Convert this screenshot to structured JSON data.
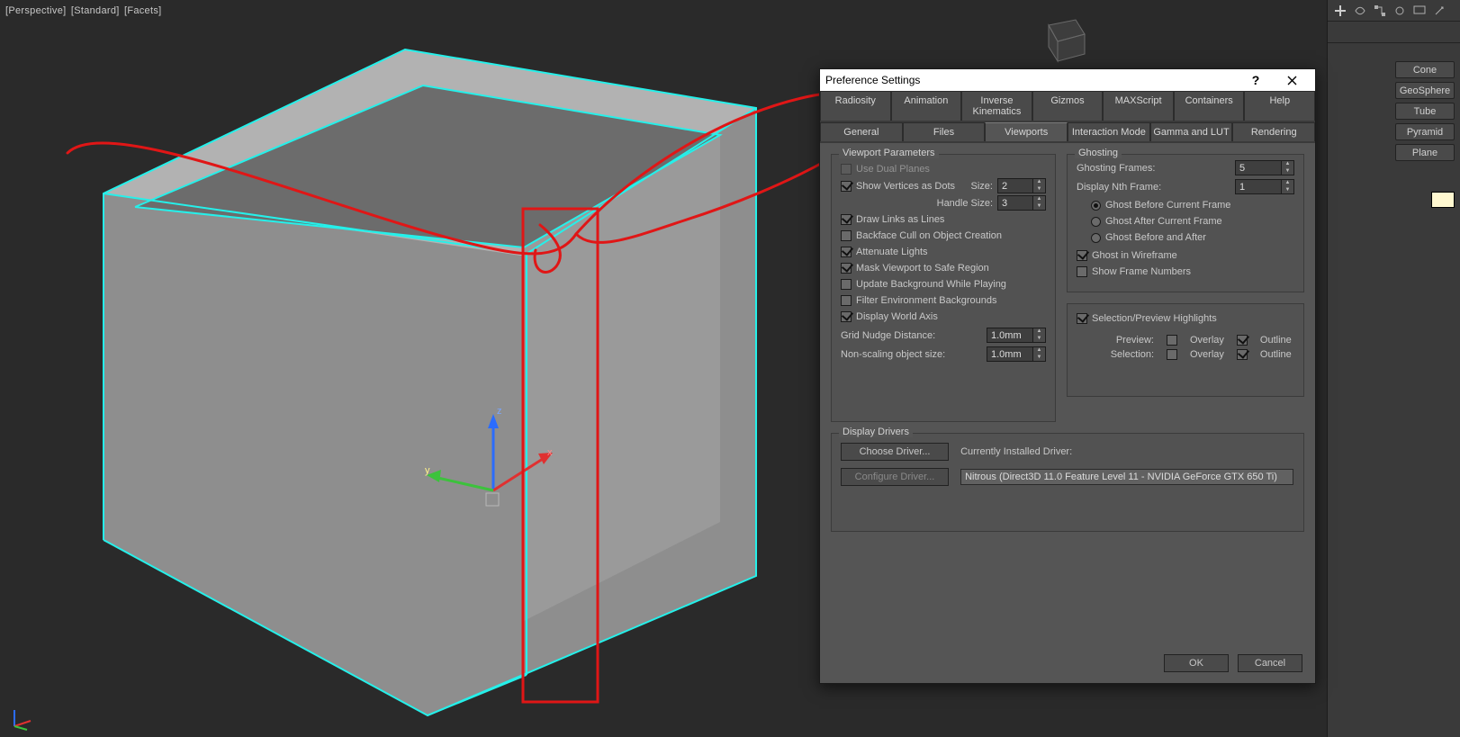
{
  "viewport": {
    "labels": [
      "[Perspective]",
      "[Standard]",
      "[Facets]"
    ]
  },
  "right_panel": {
    "buttons": [
      "Cone",
      "GeoSphere",
      "Tube",
      "Pyramid",
      "Plane"
    ]
  },
  "dialog": {
    "title": "Preference Settings",
    "tabs_row1": [
      "Radiosity",
      "Animation",
      "Inverse Kinematics",
      "Gizmos",
      "MAXScript",
      "Containers",
      "Help"
    ],
    "tabs_row2": [
      "General",
      "Files",
      "Viewports",
      "Interaction Mode",
      "Gamma and LUT",
      "Rendering"
    ],
    "active_tab": "Viewports",
    "viewport_params": {
      "title": "Viewport Parameters",
      "use_dual_planes": "Use Dual Planes",
      "show_vertices": "Show Vertices as Dots",
      "size_label": "Size:",
      "size_value": "2",
      "handle_size_label": "Handle Size:",
      "handle_size_value": "3",
      "draw_links": "Draw Links as Lines",
      "backface_cull": "Backface Cull on Object Creation",
      "attenuate": "Attenuate Lights",
      "mask_safe": "Mask Viewport to Safe Region",
      "update_bg": "Update Background While Playing",
      "filter_env": "Filter Environment Backgrounds",
      "world_axis": "Display World Axis",
      "grid_nudge_label": "Grid Nudge Distance:",
      "grid_nudge_value": "1.0mm",
      "nonscaling_label": "Non-scaling object size:",
      "nonscaling_value": "1.0mm"
    },
    "ghosting": {
      "title": "Ghosting",
      "frames_label": "Ghosting Frames:",
      "frames_value": "5",
      "nth_label": "Display Nth Frame:",
      "nth_value": "1",
      "before": "Ghost Before Current Frame",
      "after": "Ghost After Current Frame",
      "both": "Ghost Before and After",
      "wire": "Ghost in Wireframe",
      "numbers": "Show Frame Numbers"
    },
    "highlights": {
      "title_chk": "Selection/Preview Highlights",
      "preview": "Preview:",
      "selection": "Selection:",
      "overlay": "Overlay",
      "outline": "Outline"
    },
    "drivers": {
      "title": "Display Drivers",
      "choose": "Choose Driver...",
      "configure": "Configure Driver...",
      "installed_label": "Currently Installed Driver:",
      "installed_value": "Nitrous (Direct3D 11.0 Feature Level 11 - NVIDIA GeForce GTX 650 Ti)"
    },
    "footer": {
      "ok": "OK",
      "cancel": "Cancel"
    }
  }
}
